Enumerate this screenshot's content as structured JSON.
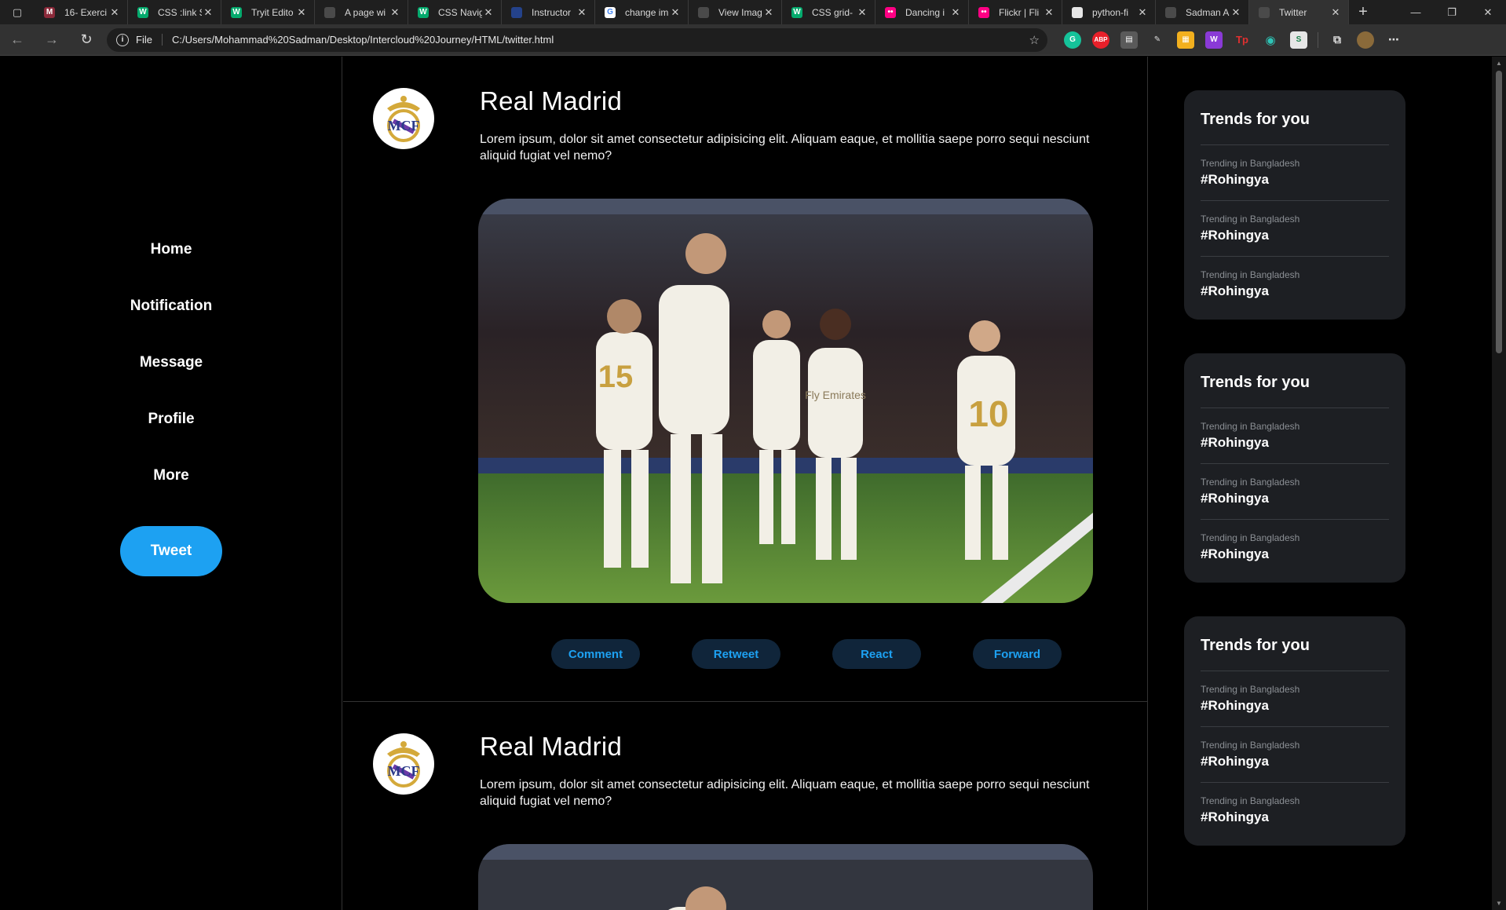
{
  "browser": {
    "tabs": [
      {
        "title": "16- Exerci",
        "fav_color": "#8b2a3a",
        "fav_glyph": "M"
      },
      {
        "title": "CSS :link S",
        "fav_color": "#04aa6d",
        "fav_glyph": "W"
      },
      {
        "title": "Tryit Edito",
        "fav_color": "#04aa6d",
        "fav_glyph": "W"
      },
      {
        "title": "A page wi",
        "fav_color": "#4a4a4a",
        "fav_glyph": ""
      },
      {
        "title": "CSS Navig",
        "fav_color": "#04aa6d",
        "fav_glyph": "W"
      },
      {
        "title": "Instructor",
        "fav_color": "#24428a",
        "fav_glyph": ""
      },
      {
        "title": "change im",
        "fav_color": "#ffffff",
        "fav_glyph": "G"
      },
      {
        "title": "View Imag",
        "fav_color": "#4a4a4a",
        "fav_glyph": ""
      },
      {
        "title": "CSS grid-",
        "fav_color": "#04aa6d",
        "fav_glyph": "W"
      },
      {
        "title": "Dancing i",
        "fav_color": "#ff0084",
        "fav_glyph": "••"
      },
      {
        "title": "Flickr | Fli",
        "fav_color": "#ff0084",
        "fav_glyph": "••"
      },
      {
        "title": "python-fi",
        "fav_color": "#e6e6e6",
        "fav_glyph": ""
      },
      {
        "title": "Sadman A",
        "fav_color": "#4a4a4a",
        "fav_glyph": ""
      },
      {
        "title": "Twitter",
        "fav_color": "#4a4a4a",
        "fav_glyph": "",
        "active": true
      }
    ],
    "scheme": "File",
    "url": "C:/Users/Mohammad%20Sadman/Desktop/Intercloud%20Journey/HTML/twitter.html"
  },
  "sidebar": {
    "items": [
      {
        "label": "Home"
      },
      {
        "label": "Notification"
      },
      {
        "label": "Message"
      },
      {
        "label": "Profile"
      },
      {
        "label": "More"
      }
    ],
    "tweet_label": "Tweet"
  },
  "posts": [
    {
      "name": "Real Madrid",
      "text": "Lorem ipsum, dolor sit amet consectetur adipisicing elit. Aliquam eaque, et mollitia saepe porro sequi nesciunt aliquid fugiat vel nemo?",
      "actions": [
        "Comment",
        "Retweet",
        "React",
        "Forward"
      ]
    },
    {
      "name": "Real Madrid",
      "text": "Lorem ipsum, dolor sit amet consectetur adipisicing elit. Aliquam eaque, et mollitia saepe porro sequi nesciunt aliquid fugiat vel nemo?"
    }
  ],
  "trends": [
    {
      "heading": "Trends for you",
      "items": [
        {
          "sub": "Trending in Bangladesh",
          "tag": "#Rohingya"
        },
        {
          "sub": "Trending in Bangladesh",
          "tag": "#Rohingya"
        },
        {
          "sub": "Trending in Bangladesh",
          "tag": "#Rohingya"
        }
      ]
    },
    {
      "heading": "Trends for you",
      "items": [
        {
          "sub": "Trending in Bangladesh",
          "tag": "#Rohingya"
        },
        {
          "sub": "Trending in Bangladesh",
          "tag": "#Rohingya"
        },
        {
          "sub": "Trending in Bangladesh",
          "tag": "#Rohingya"
        }
      ]
    },
    {
      "heading": "Trends for you",
      "items": [
        {
          "sub": "Trending in Bangladesh",
          "tag": "#Rohingya"
        },
        {
          "sub": "Trending in Bangladesh",
          "tag": "#Rohingya"
        },
        {
          "sub": "Trending in Bangladesh",
          "tag": "#Rohingya"
        }
      ]
    }
  ],
  "colors": {
    "accent": "#1da1f2",
    "action_bg": "#10253a",
    "card_bg": "#1d1f23"
  }
}
